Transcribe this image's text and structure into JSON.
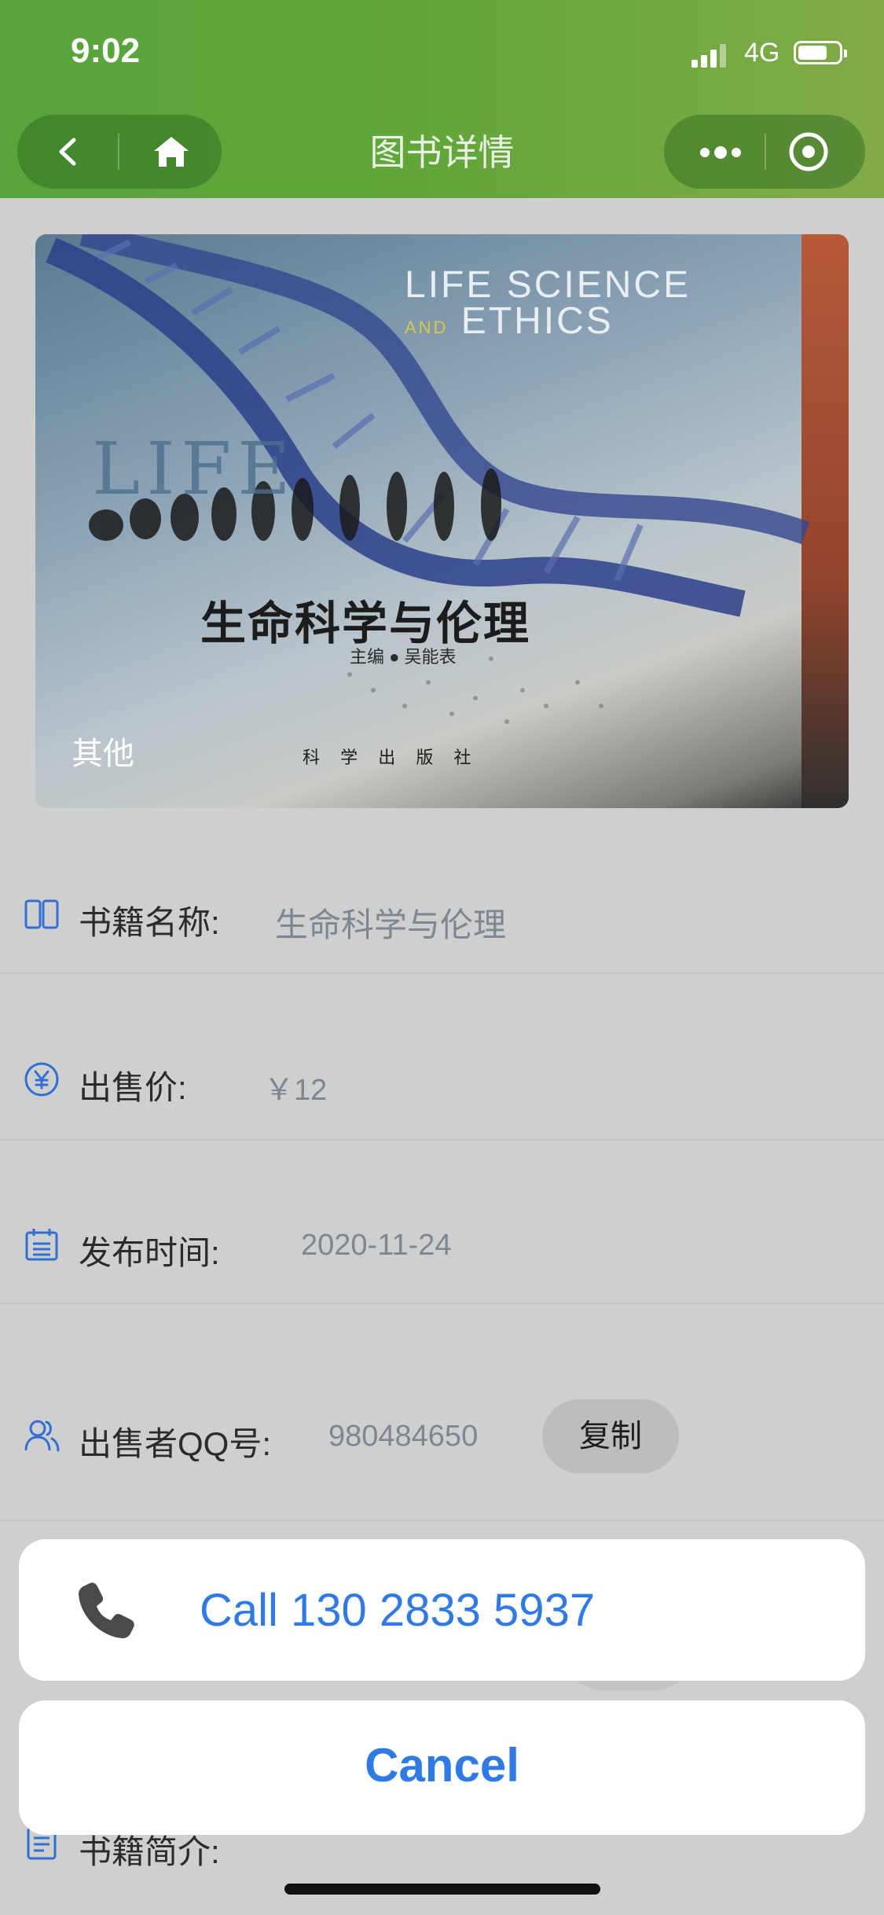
{
  "status_bar": {
    "time": "9:02",
    "network": "4G"
  },
  "nav": {
    "title": "图书详情"
  },
  "cover": {
    "category_label": "其他",
    "title_en_line1": "LIFE SCIENCE",
    "title_en_and": "AND",
    "title_en_line2": "ETHICS",
    "big_word": "LIFE",
    "title_cn": "生命科学与伦理",
    "editor": "主编 ● 吴能表",
    "publisher": "科 学 出 版 社"
  },
  "details": {
    "name_label": "书籍名称:",
    "name_value": "生命科学与伦理",
    "price_label": "出售价:",
    "price_value": "￥12",
    "date_label": "发布时间:",
    "date_value": "2020-11-24",
    "qq_label": "出售者QQ号:",
    "qq_value": "980484650",
    "copy_label": "复制",
    "intro_label": "书籍简介:"
  },
  "action_sheet": {
    "call_label": "Call 130 2833 5937",
    "cancel_label": "Cancel"
  }
}
